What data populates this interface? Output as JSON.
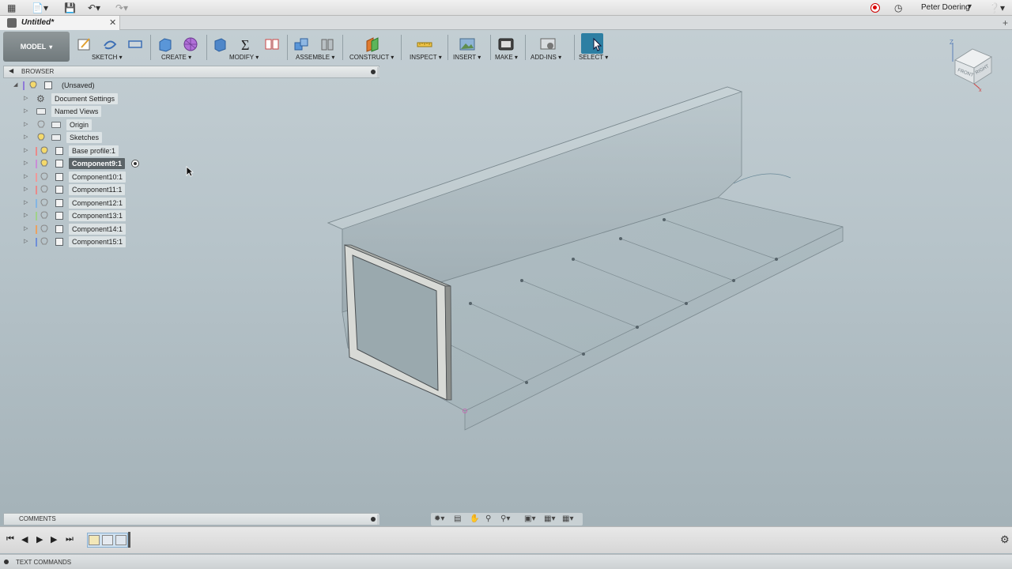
{
  "app": {
    "user_name": "Peter Doering",
    "document_tab": "Untitled*"
  },
  "toolbar": {
    "workspace": "MODEL",
    "groups": [
      {
        "key": "sketch",
        "label": "SKETCH"
      },
      {
        "key": "create",
        "label": "CREATE"
      },
      {
        "key": "modify",
        "label": "MODIFY"
      },
      {
        "key": "assemble",
        "label": "ASSEMBLE"
      },
      {
        "key": "construct",
        "label": "CONSTRUCT"
      },
      {
        "key": "inspect",
        "label": "INSPECT"
      },
      {
        "key": "insert",
        "label": "INSERT"
      },
      {
        "key": "make",
        "label": "MAKE"
      },
      {
        "key": "addins",
        "label": "ADD-INS"
      },
      {
        "key": "select",
        "label": "SELECT"
      }
    ]
  },
  "browser": {
    "title": "BROWSER",
    "items": [
      {
        "label": "(Unsaved)",
        "icon": "bulb-icon"
      },
      {
        "label": "Document Settings",
        "icon": "gear-icon"
      },
      {
        "label": "Named Views",
        "icon": "folder-icon"
      },
      {
        "label": "Origin",
        "icon": "folder-icon"
      },
      {
        "label": "Sketches",
        "icon": "folder-icon"
      },
      {
        "label": "Base profile:1",
        "icon": "component-icon"
      },
      {
        "label": "Component9:1",
        "icon": "component-icon",
        "active": true
      },
      {
        "label": "Component10:1",
        "icon": "component-icon"
      },
      {
        "label": "Component11:1",
        "icon": "component-icon"
      },
      {
        "label": "Component12:1",
        "icon": "component-icon"
      },
      {
        "label": "Component13:1",
        "icon": "component-icon"
      },
      {
        "label": "Component14:1",
        "icon": "component-icon"
      },
      {
        "label": "Component15:1",
        "icon": "component-icon"
      }
    ]
  },
  "comments": {
    "title": "COMMENTS"
  },
  "text_commands": {
    "title": "TEXT COMMANDS"
  },
  "viewcube": {
    "front": "FRONT",
    "right": "RIGHT",
    "top": "TOP",
    "axis_z": "Z"
  },
  "colors": {
    "viewport_bg": "#b6c3c9",
    "select_accent": "#2d7fa3",
    "component_colors": [
      "#e98a8a",
      "#c98ed6",
      "#ef9a9a",
      "#84b5e3",
      "#9fd28a",
      "#eaa262",
      "#6f8fd8",
      "#e36f6f"
    ]
  }
}
